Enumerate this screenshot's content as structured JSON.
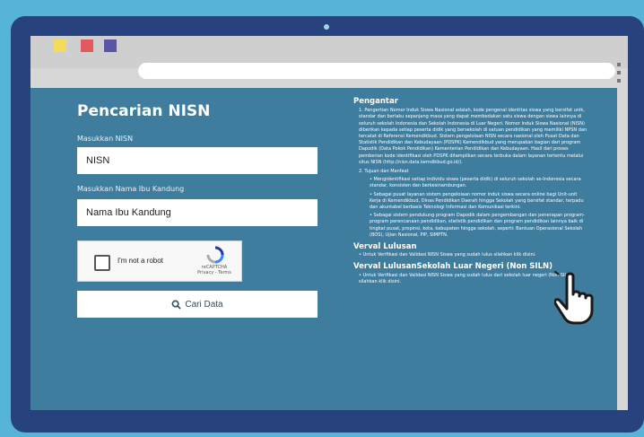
{
  "browser": {
    "window_controls": [
      "minimize",
      "close",
      "maximize"
    ]
  },
  "form": {
    "title": "Pencarian NISN",
    "nisn_label": "Masukkan NISN",
    "nisn_value": "NISN",
    "mother_label": "Masukkan Nama Ibu Kandung",
    "mother_value": "Nama Ibu Kandung",
    "captcha_label": "I'm not a robot",
    "captcha_brand": "reCAPTCHA",
    "captcha_links": "Privacy - Terms",
    "search_button": "Cari Data"
  },
  "info": {
    "heading": "Pengantar",
    "item1": "1. Pengertian Nomor Induk Siswa Nasional adalah, kode pengenal identitas siswa yang bersifat unik, standar dan berlaku sepanjang masa yang dapat membedakan satu siswa dengan siswa lainnya di seluruh sekolah Indonesia dan Sekolah Indonesia di Luar Negeri. Nomor Induk Siswa Nasional (NISN) diberikan kepada setiap peserta didik yang bersekolah di satuan pendidikan yang memiliki NPSN dan tercatat di Referensi Kemendikbud. Sistem pengelolaan NISN secara nasional oleh Pusat Data dan Statistik Pendidikan dan Kebudayaan (PDSPK) Kemendikbud yang merupakan bagian dari program Dapodik (Data Pokok Pendidikan) Kementerian Pendidikan dan Kebudayaan. Hasil dari proses pemberian kode identifikasi oleh PDSPK ditampilkan secara terbuka dalam layanan tertentu melalui situs NISN (http://nisn.data.kemdikbud.go.id/).",
    "item2_title": "2. Tujuan dan Manfaat",
    "bullet1": "• Mengidentifikasi setiap individu siswa (peserta didik) di seluruh sekolah se-Indonesia secara standar, konsisten dan berkesinambungan.",
    "bullet2": "• Sebagai pusat layanan sistem pengelolaan nomor induk siswa secara online bagi Unit-unit Kerja di Kemendikbud, Dinas Pendidikan Daerah hingga Sekolah yang bersifat standar, terpadu dan akuntabel berbasis Teknologi Informasi dan Komunikasi terkini.",
    "bullet3": "• Sebagai sistem pendukung program Dapodik dalam pengembangan dan penerapan program-program perencanaan pendidikan, statistik pendidikan dan program pendidikan lainnya baik di tingkat pusat, propinsi, kota, kabupaten hingga sekolah, seperti: Bantuan Operasional Sekolah (BOS), Ujian Nasional, PIP, SIMPTN.",
    "verval_title": "Verval Lulusan",
    "verval_text": "• Untuk Verifikasi dan Validasi NISN Siswa yang sudah lulus silahkan klik disini.",
    "siln_title": "Verval LulusanSekolah Luar Negeri (Non SILN)",
    "siln_text": "• Untuk Verifikasi dan Validasi NISN Siswa yang sudah lulus dari sekolah luar negeri (Non SILN) silahkan klik disini."
  },
  "icons": {
    "search": "search-icon",
    "pointer": "hand-pointer-icon",
    "menu": "kebab-menu-icon"
  },
  "colors": {
    "monitor": "#27427f",
    "page": "#3f7d9f",
    "background": "#55b4d8"
  }
}
